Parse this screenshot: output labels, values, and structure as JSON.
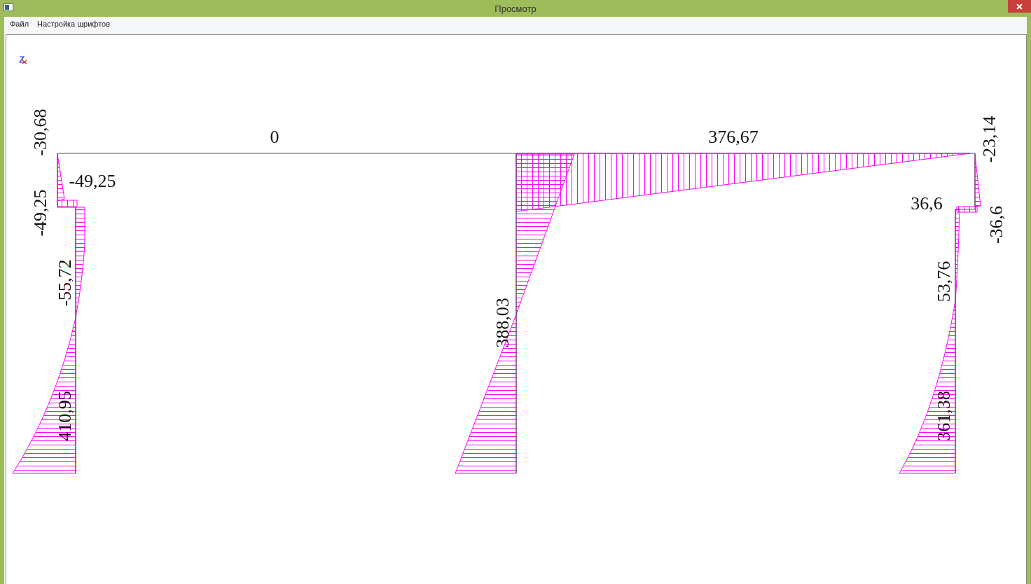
{
  "window": {
    "title": "Просмотр"
  },
  "menu": [
    {
      "label": "Файл"
    },
    {
      "label": "Настройка шрифтов"
    }
  ],
  "diagram": {
    "labels": [
      {
        "text": "-30,68",
        "kind": "vertical"
      },
      {
        "text": "0",
        "kind": "horizontal"
      },
      {
        "text": "-49,25",
        "kind": "horizontal"
      },
      {
        "text": "-49,25",
        "kind": "vertical"
      },
      {
        "text": "-55,72",
        "kind": "vertical"
      },
      {
        "text": "410,95",
        "kind": "vertical"
      },
      {
        "text": "388,03",
        "kind": "vertical"
      },
      {
        "text": "376,67",
        "kind": "horizontal"
      },
      {
        "text": "-23,14",
        "kind": "vertical"
      },
      {
        "text": "36,6",
        "kind": "horizontal"
      },
      {
        "text": "-36,6",
        "kind": "vertical"
      },
      {
        "text": "53,76",
        "kind": "vertical"
      },
      {
        "text": "361,38",
        "kind": "vertical"
      }
    ]
  }
}
